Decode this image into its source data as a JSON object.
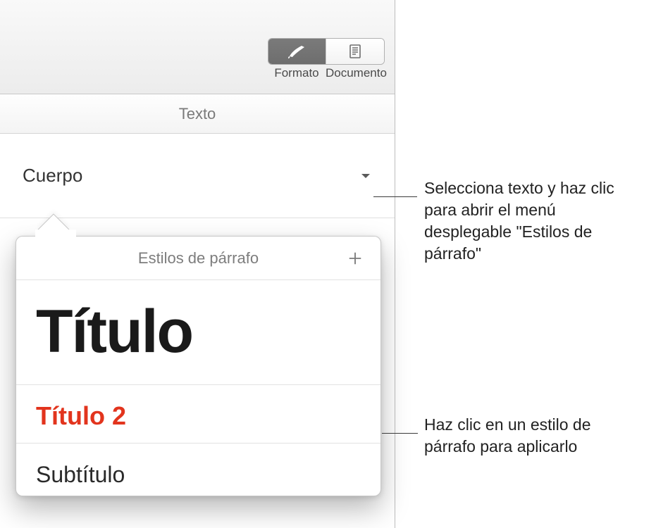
{
  "toolbar": {
    "format_label": "Formato",
    "document_label": "Documento"
  },
  "section": {
    "title": "Texto"
  },
  "selector": {
    "current_style": "Cuerpo"
  },
  "popover": {
    "title": "Estilos de párrafo",
    "items": [
      {
        "label": "Título",
        "class": "style-titulo"
      },
      {
        "label": "Título 2",
        "class": "style-titulo2"
      },
      {
        "label": "Subtítulo",
        "class": "style-subtitulo"
      }
    ]
  },
  "callouts": {
    "c1": "Selecciona texto y haz clic para abrir el menú desplegable \"Estilos de párrafo\"",
    "c2": "Haz clic en un estilo de párrafo para aplicarlo"
  }
}
